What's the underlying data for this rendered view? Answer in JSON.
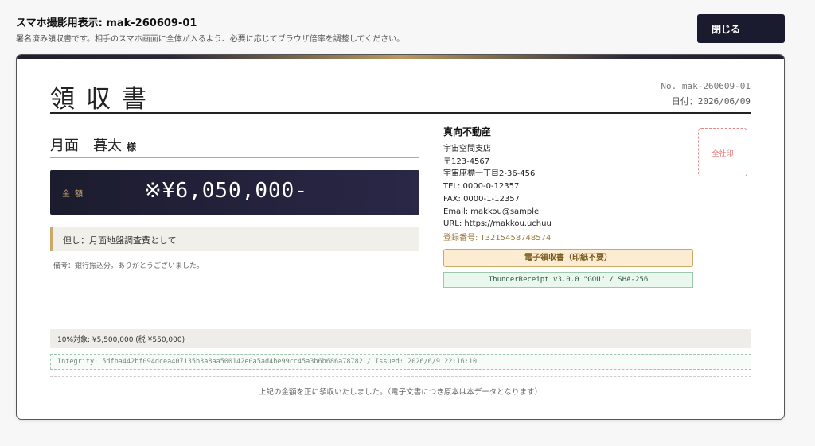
{
  "header": {
    "title": "スマホ撮影用表示: mak-260609-01",
    "subtitle": "署名済み領収書です。相手のスマホ画面に全体が入るよう、必要に応じてブラウザ倍率を調整してください。",
    "close_label": "閉じる"
  },
  "receipt": {
    "title": "領収書",
    "number": "No. mak-260609-01",
    "date": "日付：2026/06/09",
    "recipient": {
      "name": "月面　暮太",
      "suffix": "様"
    },
    "amount": {
      "label": "金額",
      "value": "※¥6,050,000-"
    },
    "purpose": "但し：月面地盤調査費として",
    "remarks": "備考：銀行振込分。ありがとうございました。",
    "issuer": {
      "name": "真向不動産",
      "branch": "宇宙空間支店",
      "postal": "〒123-4567",
      "address": "宇宙座標一丁目2-36-456",
      "tel": "TEL: 0000-0-12357",
      "fax": "FAX: 0000-1-12357",
      "email": "Email: makkou@sample",
      "url": "URL: https://makkou.uchuu",
      "registration": "登録番号: T3215458748574"
    },
    "stamp_label": "全社印",
    "electronic_badge": "電子領収書（印紙不要）",
    "version_badge": "ThunderReceipt v3.0.0 \"GOU\" / SHA-256",
    "tax_breakdown": "10%対象: ¥5,500,000 (税 ¥550,000)",
    "integrity": "Integrity: 5dfba442bf094dcea407135b3a8aa500142e0a5ad4be99cc45a3b6b686a78782 / Issued: 2026/6/9 22:16:10",
    "footer_note": "上記の金額を正に領収いたしました。（電子文書につき原本は本データとなります）"
  },
  "colors": {
    "navy": "#1b1b2f",
    "gold": "#c9a96a",
    "stamp_red": "#e07070",
    "integrity_green": "#9cc9ab"
  }
}
